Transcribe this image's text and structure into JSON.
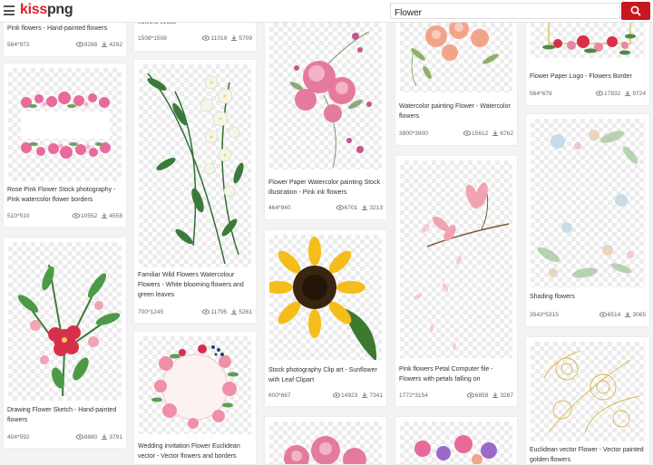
{
  "header": {
    "logo_part1": "kiss",
    "logo_part2": "png",
    "search_value": "Flower",
    "menu_icon": "hamburger-menu-icon",
    "search_icon": "magnifier-icon"
  },
  "colors": {
    "brand_red": "#d8232a",
    "button_red": "#c8161d"
  },
  "cards": [
    {
      "title": "Pink flowers - Hand-painted flowers",
      "dims": "564*972",
      "views": "9288",
      "downloads": "4292"
    },
    {
      "title": "Rose Pink Flower Stock photography - Pink watercolor flower borders",
      "dims": "510*510",
      "views": "10552",
      "downloads": "4558"
    },
    {
      "title": "Drawing Flower Sketch - Hand-painted flowers",
      "dims": "404*592",
      "views": "8880",
      "downloads": "3791"
    },
    {
      "title": "flowers vector",
      "dims": "1508*1508",
      "views": "11019",
      "downloads": "5709"
    },
    {
      "title": "Familiar Wild Flowers Watercolour Flowers - White blooming flowers and green leaves",
      "dims": "700*1245",
      "views": "11795",
      "downloads": "5261"
    },
    {
      "title": "Wedding invitation Flower Euclidean vector - Vector flowers and borders",
      "dims": "",
      "views": "",
      "downloads": ""
    },
    {
      "title": "Flower Paper Watercolor painting Stock illustration - Pink ink flowers",
      "dims": "464*840",
      "views": "6701",
      "downloads": "3213"
    },
    {
      "title": "Stock photography Clip art - Sunflower with Leaf Clipart",
      "dims": "600*667",
      "views": "14923",
      "downloads": "7341"
    },
    {
      "title": "Watercolor painting Flower - Watercolor flowers",
      "dims": "3900*3900",
      "views": "15612",
      "downloads": "6762"
    },
    {
      "title": "Pink flowers Petal Computer file - Flowers with petals falling on",
      "dims": "1772*3154",
      "views": "6858",
      "downloads": "3287"
    },
    {
      "title": "Flower Paper Logo - Flowers Border",
      "dims": "564*679",
      "views": "17832",
      "downloads": "9724"
    },
    {
      "title": "Shading flowers",
      "dims": "3543*5315",
      "views": "6514",
      "downloads": "3065"
    },
    {
      "title": "Euclidean vector Flower - Vector painted golden flowers",
      "dims": "",
      "views": "",
      "downloads": ""
    }
  ]
}
